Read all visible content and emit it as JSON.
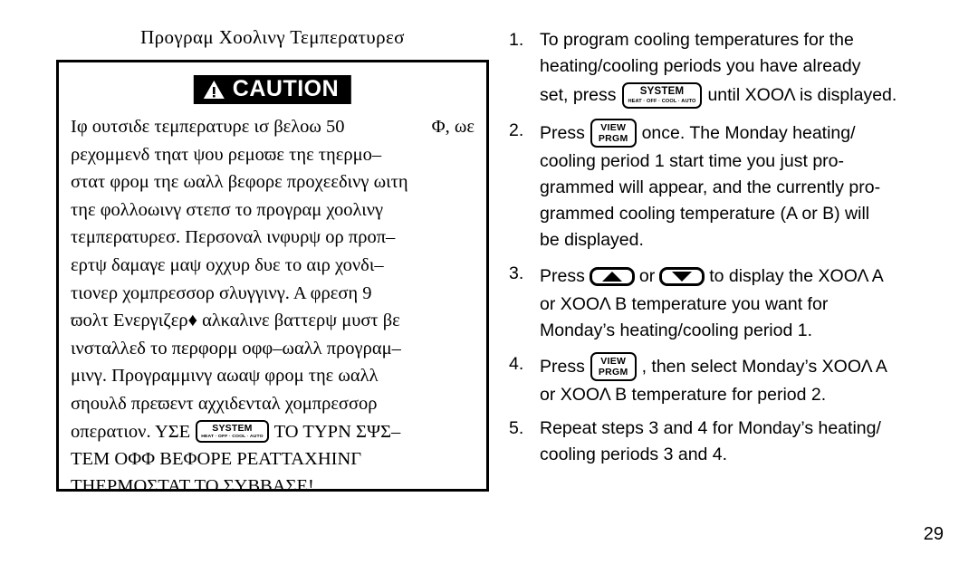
{
  "page": {
    "number": "29"
  },
  "left_column": {
    "section_title": "Προγραμ Χοολινγ Τεμπερατυρεσ",
    "caution_box": {
      "banner_label": "CAUTION",
      "banner_icon": "warning-triangle-icon",
      "body_lines": [
        "Ιφ ουτσιδε τεμπερατυρε ισ βελοω 50",
        "Φ, ωε",
        "ρεχομμενδ τηατ ψου ρεμοϖε τηε τηερμο–",
        "στατ φρομ τηε ωαλλ βεφορε προχεεδινγ ωιτη",
        "τηε φολλοωινγ στεπσ το προγραμ χοολινγ",
        "τεμπερατυρεσ. Περσοναλ ινφυρψ ορ προπ–",
        "ερτψ δαμαγε μαψ οχχυρ δυε το αιρ χονδι–",
        "τιονερ χομπρεσσορ σλυγγινγ. Α φρεση 9",
        "ϖολτ Ενεργιζερ♦ αλκαλινε βαττερψ μυστ βε",
        "ινσταλλεδ το περφορμ οφφ–ωαλλ προγραμ–",
        "μινγ. Προγραμμινγ αωαψ φρομ τηε ωαλλ",
        "σηουλδ πρεϖεντ αχχιδενταλ χομπρεσσορ"
      ],
      "button_line_prefix": "οπερατιον. ΥΣΕ",
      "button_line_suffix": "ΤΟ ΤΥΡΝ ΣΨΣ–",
      "final_lines": [
        "ΤΕΜ ΟΦΦ ΒΕΦΟΡΕ ΡΕΑΤΤΑΧΗΙΝΓ",
        "ΤΗΕΡΜΟΣΤΑΤ ΤΟ ΣΥΒΒΑΣΕ!"
      ]
    }
  },
  "buttons": {
    "system": {
      "main_label": "SYSTEM",
      "sub_label": "HEAT · OFF · COOL · AUTO"
    },
    "view_prgm": {
      "line1": "VIEW",
      "line2": "PRGM"
    },
    "up_arrow": {
      "icon": "triangle-up-icon"
    },
    "down_arrow": {
      "icon": "triangle-down-icon"
    }
  },
  "right_column": {
    "steps": [
      {
        "number": "1.",
        "lines": [
          {
            "type": "text",
            "text": "To program cooling temperatures for the"
          },
          {
            "type": "text",
            "text": "heating/cooling periods you have already"
          },
          {
            "type": "button",
            "before": "set, press",
            "button": "system",
            "after": "until ΧΟΟΛ is displayed."
          }
        ]
      },
      {
        "number": "2.",
        "lines": [
          {
            "type": "button",
            "before": "Press",
            "button": "view_prgm",
            "after": "once. The Monday heating/"
          },
          {
            "type": "text",
            "text": "cooling period 1 start time you just pro-"
          },
          {
            "type": "text",
            "text": "grammed will appear, and the currently pro-"
          },
          {
            "type": "text",
            "text": "grammed cooling temperature (A or B) will"
          },
          {
            "type": "text",
            "text": "be displayed."
          }
        ]
      },
      {
        "number": "3.",
        "lines": [
          {
            "type": "arrows",
            "before": "Press",
            "middle": "or",
            "after": "to display the ΧΟΟΛ Α"
          },
          {
            "type": "text",
            "text": "or ΧΟΟΛ Β temperature you want for"
          },
          {
            "type": "text",
            "text": "Monday’s heating/cooling period 1."
          }
        ]
      },
      {
        "number": "4.",
        "lines": [
          {
            "type": "button",
            "before": "Press",
            "button": "view_prgm",
            "after": ", then select Monday’s ΧΟΟΛ Α"
          },
          {
            "type": "text",
            "text": "or ΧΟΟΛ Β temperature for period 2."
          }
        ]
      },
      {
        "number": "5.",
        "lines": [
          {
            "type": "text",
            "text": "Repeat steps 3 and 4 for Monday’s heating/"
          },
          {
            "type": "text",
            "text": "cooling periods 3 and 4."
          }
        ]
      }
    ]
  },
  "colors": {
    "ink": "#000000",
    "paper": "#ffffff"
  }
}
